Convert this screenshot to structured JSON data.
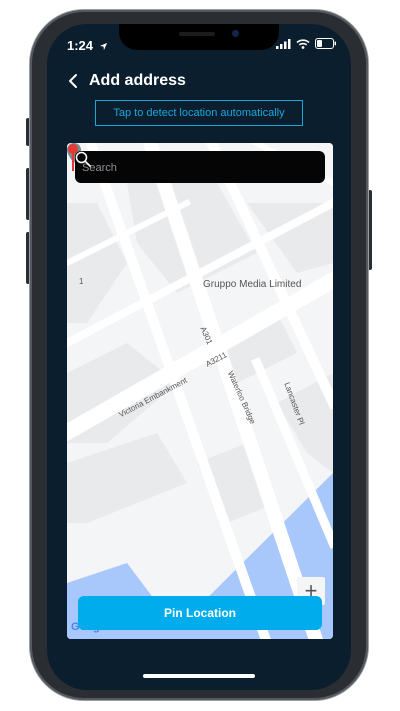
{
  "status_bar": {
    "time": "1:24"
  },
  "header": {
    "title": "Add address"
  },
  "detect_button": {
    "label": "Tap to detect location automatically"
  },
  "search": {
    "placeholder": "Search"
  },
  "map": {
    "poi_name": "Gruppo Media Limited",
    "street_labels": [
      "Victoria Embankment",
      "A3211",
      "A301",
      "Waterloo Bridge",
      "Lancaster Pl",
      "1"
    ],
    "attribution": "Google"
  },
  "pin_button": {
    "label": "Pin Location"
  },
  "zoom_button": {
    "label": "+"
  },
  "colors": {
    "accent": "#00acec",
    "background": "#0b1e2e",
    "pin": "#e53935",
    "water": "#a8c7fa"
  }
}
